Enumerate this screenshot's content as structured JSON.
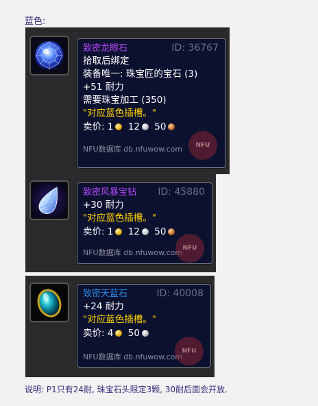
{
  "heading": "蓝色:",
  "items": [
    {
      "icon": "blue-faceted-gem-icon",
      "name": "致密龙眼石",
      "id_label": "ID: 36767",
      "lines": [
        "拾取后绑定",
        "装备唯一: 珠宝匠的宝石 (3)",
        "+51 耐力",
        "需要珠宝加工 (350)"
      ],
      "quote": "\"对应蓝色插槽。\"",
      "price_label": "卖价:",
      "gold": "1",
      "silver": "12",
      "copper": "50",
      "footer": "NFU数据库 db.nfuwow.com",
      "watermark": "NFU"
    },
    {
      "icon": "teardrop-gem-icon",
      "name": "致密风暴宝钻",
      "id_label": "ID: 45880",
      "lines": [
        "+30 耐力"
      ],
      "quote": "\"对应蓝色插槽。\"",
      "price_label": "卖价:",
      "gold": "1",
      "silver": "12",
      "copper": "50",
      "footer": "NFU数据库 db.nfuwow.com",
      "watermark": "NFU"
    },
    {
      "icon": "oval-cabochon-gem-icon",
      "name": "致密天蓝石",
      "id_label": "ID: 40008",
      "lines": [
        "+24 耐力"
      ],
      "quote": "\"对应蓝色插槽。\"",
      "price_label": "卖价:",
      "gold": "4",
      "silver": "50",
      "footer": "NFU数据库 db.nfuwow.com",
      "watermark": "NFU"
    }
  ],
  "note": "说明: P1只有24耐, 珠宝石头限定3颗, 30耐后面会开放."
}
